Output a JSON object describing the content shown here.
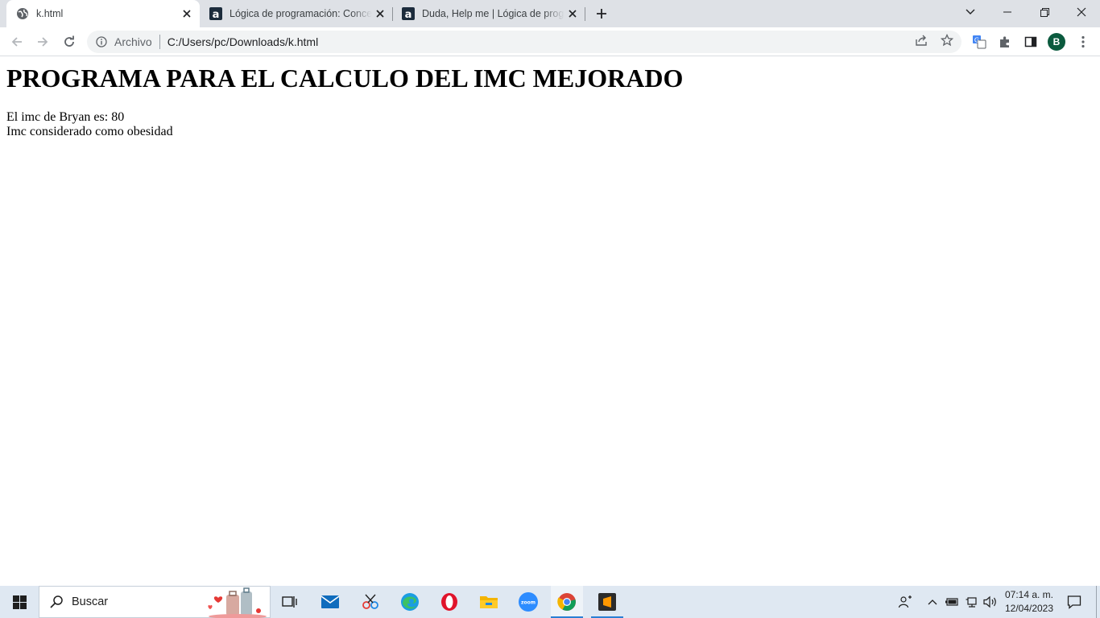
{
  "browser": {
    "tabs": [
      {
        "title": "k.html",
        "icon": "globe-icon",
        "active": true
      },
      {
        "title": "Lógica de programación: Concep",
        "icon": "alura-icon",
        "active": false
      },
      {
        "title": "Duda, Help me | Lógica de progr",
        "icon": "alura-icon",
        "active": false
      }
    ],
    "omnibox": {
      "scheme_label": "Archivo",
      "url": "C:/Users/pc/Downloads/k.html"
    },
    "profile_initial": "B"
  },
  "page": {
    "heading": "PROGRAMA PARA EL CALCULO DEL IMC MEJORADO",
    "lines": [
      "El imc de Bryan es: 80",
      "Imc considerado como obesidad"
    ]
  },
  "taskbar": {
    "search_placeholder": "Buscar",
    "apps": [
      "task-view",
      "mail",
      "snipping-tool",
      "edge",
      "opera",
      "file-explorer",
      "zoom",
      "chrome",
      "sublime-text"
    ],
    "zoom_label": "zoom",
    "clock_time": "07:14 a. m.",
    "clock_date": "12/04/2023"
  },
  "colors": {
    "tabstrip_bg": "#dee1e6",
    "taskbar_bg": "#dfe8f2",
    "profile_bg": "#0b5a3e",
    "chrome_active_underline": "#2a7fd4"
  }
}
